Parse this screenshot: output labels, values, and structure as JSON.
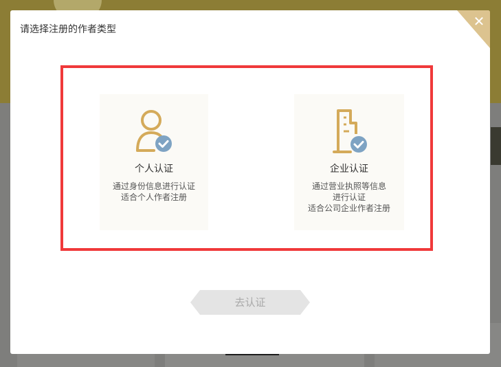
{
  "modal": {
    "title": "请选择注册的作者类型",
    "close_icon": "close-icon",
    "options": [
      {
        "title": "个人认证",
        "icon": "person-verified-icon",
        "desc_lines": [
          "通过身份信息进行认证",
          "适合个人作者注册"
        ]
      },
      {
        "title": "企业认证",
        "icon": "document-verified-icon",
        "desc_lines": [
          "通过营业执照等信息",
          "进行认证",
          "适合公司企业作者注册"
        ]
      }
    ],
    "submit_label": "去认证"
  },
  "colors": {
    "accent_gold": "#d4aa5a",
    "check_blue": "#7ea3c3",
    "highlight_red": "#f0393a",
    "close_corner": "#dcc38f",
    "disabled_button": "#e4e4e4"
  }
}
